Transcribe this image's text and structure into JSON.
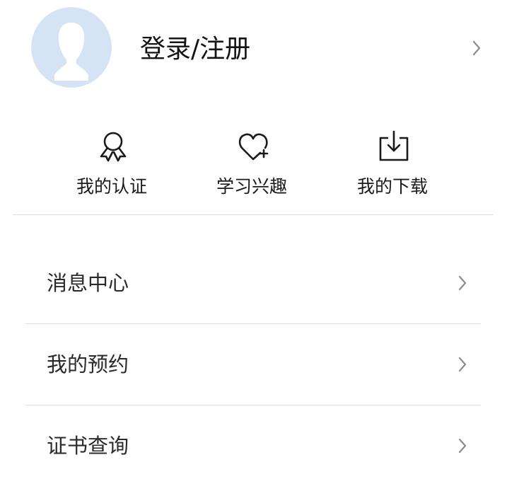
{
  "profile": {
    "login_label": "登录/注册",
    "avatar_icon": "default-avatar-icon",
    "chevron_icon": "chevron-right-icon"
  },
  "quick_actions": [
    {
      "label": "我的认证",
      "icon": "certification-ribbon-icon"
    },
    {
      "label": "学习兴趣",
      "icon": "heart-plus-icon"
    },
    {
      "label": "我的下载",
      "icon": "download-tray-icon"
    }
  ],
  "menu": {
    "items": [
      {
        "label": "消息中心",
        "icon": "chevron-right-icon"
      },
      {
        "label": "我的预约",
        "icon": "chevron-right-icon"
      },
      {
        "label": "证书查询",
        "icon": "chevron-right-icon"
      }
    ]
  },
  "colors": {
    "avatar_bg": "#d6e3f4",
    "avatar_figure": "#ffffff",
    "divider": "#dedede",
    "chevron": "#8c8c8c",
    "text": "#1f1f1f"
  }
}
